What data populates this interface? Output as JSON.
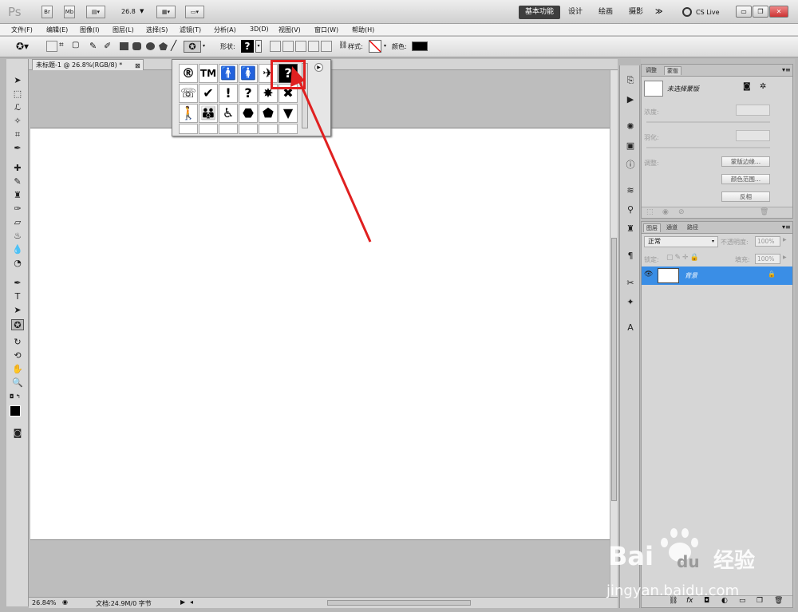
{
  "titlebar": {
    "app_logo": "Ps",
    "br_label": "Br",
    "mb_label": "Mb",
    "zoom": "26.8",
    "workspaces": [
      "基本功能",
      "设计",
      "绘画",
      "摄影"
    ],
    "more": "≫",
    "cs_live": "CS Live"
  },
  "menubar": {
    "items": [
      "文件(F)",
      "编辑(E)",
      "图像(I)",
      "图层(L)",
      "选择(S)",
      "滤镜(T)",
      "分析(A)",
      "3D(D)",
      "视图(V)",
      "窗口(W)",
      "帮助(H)"
    ]
  },
  "optionsbar": {
    "shape_label": "形状:",
    "style_label": "样式:",
    "color_label": "颜色:",
    "color_value": "#000000"
  },
  "document": {
    "tab_title": "未标题-1 @ 26.8%(RGB/8) *",
    "zoom_status": "26.84%",
    "doc_status": "文档:24.9M/0 字节"
  },
  "shape_popup": {
    "row1": [
      "®",
      "TM",
      "🚹",
      "🚺",
      "✈",
      "?"
    ],
    "row2": [
      "☏",
      "✔",
      "!",
      "?",
      "✸",
      "✖"
    ],
    "row3": [
      "🚶",
      "👪",
      "♿",
      "⬣",
      "⬟",
      "▼"
    ]
  },
  "masks_panel": {
    "tab_adjust": "调整",
    "tab_masks": "蒙版",
    "no_mask": "未选择蒙版",
    "density": "浓度:",
    "feather": "羽化:",
    "refine": "调整:",
    "btn_edge": "蒙版边缘...",
    "btn_color_range": "颜色范围...",
    "btn_invert": "反相"
  },
  "layers_panel": {
    "tab_layers": "图层",
    "tab_channels": "通道",
    "tab_paths": "路径",
    "blend_mode": "正常",
    "opacity_label": "不透明度:",
    "opacity_value": "100%",
    "lock_label": "锁定:",
    "fill_label": "填充:",
    "fill_value": "100%",
    "layer_name": "背景",
    "selection_color": "#3a8ee6"
  },
  "watermark": {
    "brand": "Bai",
    "brand2": "du",
    "cn": "经验",
    "url": "jingyan.baidu.com"
  },
  "colors": {
    "annotation_red": "#e02020"
  }
}
